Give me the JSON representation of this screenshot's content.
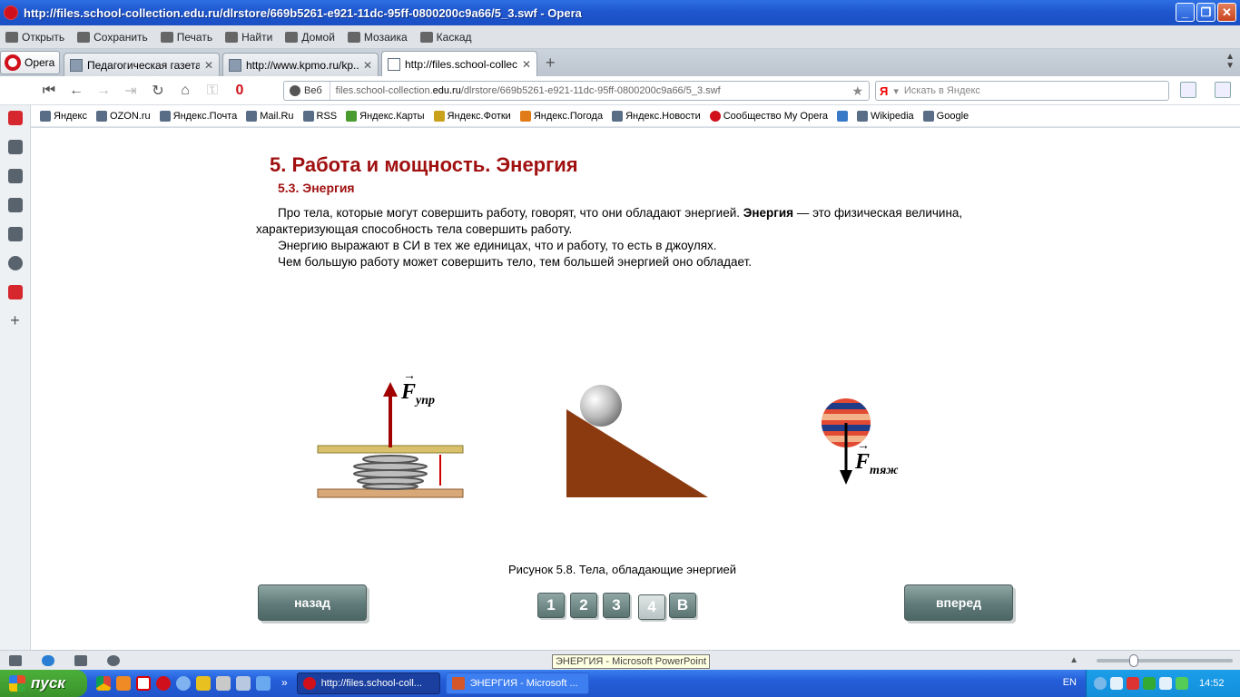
{
  "window": {
    "title": "http://files.school-collection.edu.ru/dlrstore/669b5261-e921-11dc-95ff-0800200c9a66/5_3.swf - Opera",
    "buttons": {
      "minimize": "_",
      "maximize": "❐",
      "close": "✕"
    }
  },
  "menubar": {
    "items": [
      {
        "label": "Открыть",
        "icon": "folder-icon"
      },
      {
        "label": "Сохранить",
        "icon": "save-icon"
      },
      {
        "label": "Печать",
        "icon": "print-icon"
      },
      {
        "label": "Найти",
        "icon": "find-icon"
      },
      {
        "label": "Домой",
        "icon": "home-icon"
      },
      {
        "label": "Мозаика",
        "icon": "tile-icon"
      },
      {
        "label": "Каскад",
        "icon": "cascade-icon"
      }
    ]
  },
  "tabs": {
    "menu_label": "Opera",
    "items": [
      {
        "label": "Педагогическая газета",
        "close": "✕"
      },
      {
        "label": "http://www.kpmo.ru/kp...",
        "close": "✕"
      },
      {
        "label": "http://files.school-collect...",
        "close": "✕",
        "active": true
      }
    ],
    "new_tab": "+"
  },
  "addressbar": {
    "badge": "Веб",
    "url_prefix": "files.school-collection.",
    "url_domain": "edu.ru",
    "url_suffix": "/dlrstore/669b5261-e921-11dc-95ff-0800200c9a66/5_3.swf",
    "search_logo": "Я",
    "search_placeholder": "Искать в Яндекс"
  },
  "bookmarks": [
    "Яндекс",
    "OZON.ru",
    "Яндекс.Почта",
    "Mail.Ru",
    "RSS",
    "Яндекс.Карты",
    "Яндекс.Фотки",
    "Яндекс.Погода",
    "Яндекс.Новости",
    "Сообщество My Opera",
    "Wikipedia",
    "Google"
  ],
  "content": {
    "title": "5. Работа и мощность. Энергия",
    "subtitle": "5.3. Энергия",
    "p1_a": "Про тела, которые могут совершить работу, говорят, что они обладают энергией. ",
    "p1_bold": "Энергия",
    "p1_b": " — это физическая величина, характеризующая способность тела совершить работу.",
    "p2": "Энергию выражают в СИ в тех же единицах, что и работу, то есть в джоулях.",
    "p3": "Чем большую работу может совершить тело, тем большей энергией оно обладает.",
    "force_spring": "F",
    "force_spring_sub": "упр",
    "force_gravity": "F",
    "force_gravity_sub": "тяж",
    "caption": "Рисунок 5.8. Тела, обладающие энергией",
    "back_label": "назад",
    "forward_label": "вперед",
    "pages": [
      "1",
      "2",
      "3",
      "4",
      "В"
    ],
    "current_page": "4"
  },
  "statusbar": {
    "tooltip": "ЭНЕРГИЯ - Microsoft PowerPoint"
  },
  "taskbar": {
    "start_label": "пуск",
    "chevron": "»",
    "tasks": [
      {
        "label": "http://files.school-coll...",
        "active": true
      },
      {
        "label": "ЭНЕРГИЯ - Microsoft ...",
        "active": false
      }
    ],
    "lang": "EN",
    "clock": "14:52"
  },
  "colors": {
    "heading": "#a01010",
    "button": "#5f7a78",
    "spring_plate_top": "#d8c16a",
    "spring_plate_bottom": "#d9a878",
    "wedge": "#8b3a10",
    "arrow_red": "#a00000"
  }
}
